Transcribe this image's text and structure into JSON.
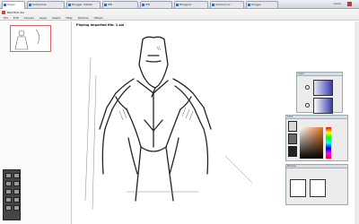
{
  "browser": {
    "tabs": [
      "Imgur",
      "Ustreamer",
      "Blogger: Rafael",
      "IPB",
      "IPB",
      "Blogspot",
      "Ustream.tv",
      "blogger"
    ],
    "user": "name"
  },
  "app": {
    "title": "PaintTool SAI",
    "menus": [
      "File",
      "Edit",
      "Canvas",
      "Layer",
      "Select",
      "Filter",
      "Window",
      "Others"
    ]
  },
  "canvas": {
    "file_label": "Playing imported file: 1.sai"
  },
  "panels": {
    "layers": {
      "title": "Layer"
    },
    "color": {
      "title": "Color"
    },
    "preview": {
      "title": "Preview"
    }
  },
  "colors": {
    "accent": "#e8711a",
    "brand": "#3d3db0"
  }
}
